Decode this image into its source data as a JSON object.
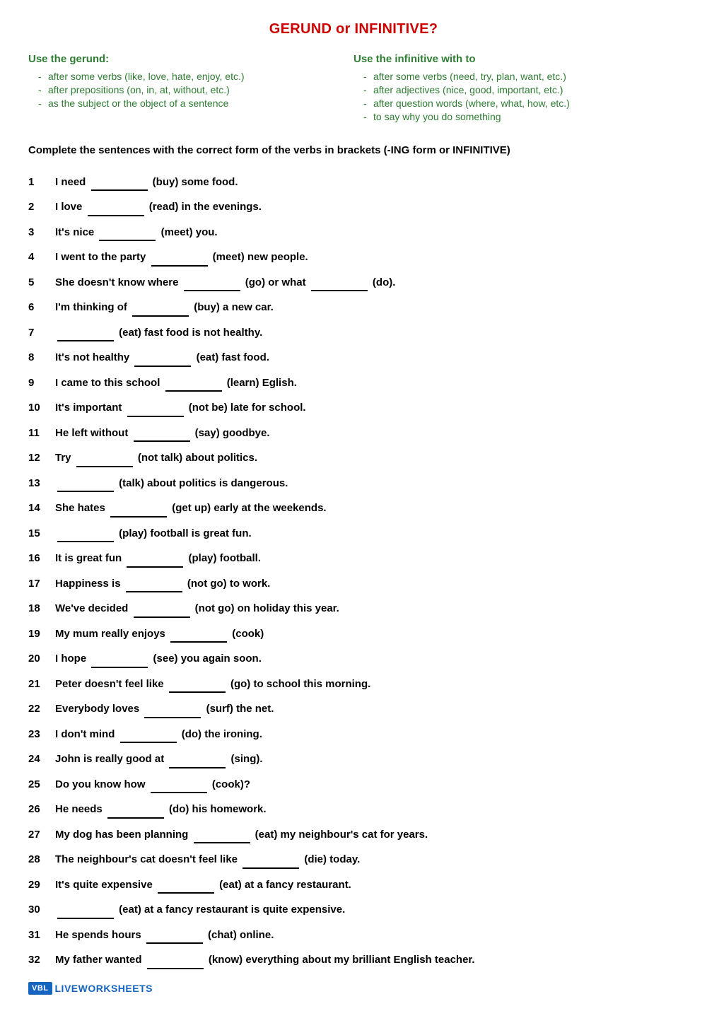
{
  "title": "GERUND or INFINITIVE?",
  "gerund": {
    "heading": "Use the gerund:",
    "items": [
      "after some verbs (like, love, hate, enjoy,  etc.)",
      "after prepositions (on, in, at, without, etc.)",
      "as the subject or the object of a sentence"
    ]
  },
  "infinitive": {
    "heading": "Use the infinitive with to",
    "items": [
      "after some verbs (need, try, plan, want, etc.)",
      "after adjectives (nice, good, important, etc.)",
      "after question words (where, what, how, etc.)",
      "to say why you do something"
    ]
  },
  "instructions": "Complete the sentences with the correct form of the verbs in brackets (-ING form or INFINITIVE)",
  "exercises": [
    {
      "num": "1",
      "text": "I need __________ (buy) some food."
    },
    {
      "num": "2",
      "text": "I love ________ (read) in the evenings."
    },
    {
      "num": "3",
      "text": "It's nice ________ (meet) you."
    },
    {
      "num": "4",
      "text": "I went to the party ________ (meet) new people."
    },
    {
      "num": "5",
      "text": "She doesn't know where ________ (go) or what ________ (do)."
    },
    {
      "num": "6",
      "text": "I'm thinking of ________ (buy) a new car."
    },
    {
      "num": "7",
      "text": "________ (eat) fast food is not healthy."
    },
    {
      "num": "8",
      "text": "It's not healthy ________ (eat) fast food."
    },
    {
      "num": "9",
      "text": "I came to this school ________ (learn) Eglish."
    },
    {
      "num": "10",
      "text": "It's important ________ (not be) late for school."
    },
    {
      "num": "11",
      "text": "He left without ________ (say) goodbye."
    },
    {
      "num": "12",
      "text": "Try ________ (not talk) about politics."
    },
    {
      "num": "13",
      "text": "________ (talk) about politics is dangerous."
    },
    {
      "num": "14",
      "text": "She hates ________ (get up) early at the weekends."
    },
    {
      "num": "15",
      "text": "________ (play) football is great fun."
    },
    {
      "num": "16",
      "text": "It is great fun ________ (play) football."
    },
    {
      "num": "17",
      "text": "Happiness is ________ (not go) to work."
    },
    {
      "num": "18",
      "text": "We've decided ________ (not go) on holiday this year."
    },
    {
      "num": "19",
      "text": "My mum really enjoys ________ (cook)"
    },
    {
      "num": "20",
      "text": "I hope ________ (see) you again soon."
    },
    {
      "num": "21",
      "text": "Peter doesn't feel like ________ (go) to school this morning."
    },
    {
      "num": "22",
      "text": "Everybody loves ________ (surf) the net."
    },
    {
      "num": "23",
      "text": "I don't mind ________ (do) the ironing."
    },
    {
      "num": "24",
      "text": "John is really good at ________ (sing)."
    },
    {
      "num": "25",
      "text": "Do you know how ________ (cook)?"
    },
    {
      "num": "26",
      "text": "He needs ________ (do) his homework."
    },
    {
      "num": "27",
      "text": "My dog has been planning ________ (eat) my neighbour's cat for years."
    },
    {
      "num": "28",
      "text": "The neighbour's cat doesn't feel like ________ (die) today."
    },
    {
      "num": "29",
      "text": "It's quite expensive ________ (eat) at a fancy restaurant."
    },
    {
      "num": "30",
      "text": "________ (eat) at a fancy restaurant is quite expensive."
    },
    {
      "num": "31",
      "text": "He spends hours ________ (chat) online."
    },
    {
      "num": "32",
      "text": "My father wanted ________ (know) everything about my brilliant English teacher."
    }
  ],
  "footer": {
    "logo_abbr": "VBL",
    "logo_name": "LIVEWORKSHEETS"
  }
}
